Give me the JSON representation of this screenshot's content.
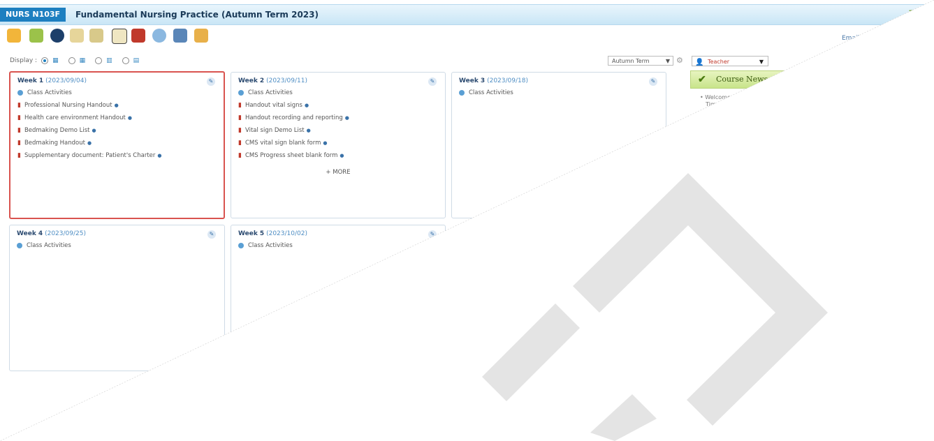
{
  "header": {
    "course_code": "NURS N103F",
    "course_title": "Fundamental Nursing Practice (Autumn Term 2023)",
    "brand": "m"
  },
  "toolbar": {
    "icons": [
      "home-icon",
      "folder-icon",
      "record-icon",
      "clipboard-icon",
      "clipboard-edit-icon",
      "document-icon",
      "books-icon",
      "clock-icon",
      "monitor-icon",
      "palette-icon"
    ],
    "email_label": "Email"
  },
  "display": {
    "label": "Display :",
    "options": [
      "grid-3-view",
      "grid-2-view",
      "single-view",
      "calendar-view"
    ]
  },
  "term": {
    "value": "Autumn Term"
  },
  "role": {
    "value": "Teacher"
  },
  "news": {
    "title": "Course News",
    "welcome": "Welcome",
    "body_tail": "Time"
  },
  "weeks": [
    {
      "title": "Week 1",
      "date": "(2023/09/04)",
      "activities": "Class Activities",
      "items": [
        "Professional Nursing Handout",
        "Health care environment Handout",
        "Bedmaking Demo List",
        "Bedmaking Handout",
        "Supplementary document: Patient's Charter"
      ]
    },
    {
      "title": "Week 2",
      "date": "(2023/09/11)",
      "activities": "Class Activities",
      "items": [
        "Handout vital signs",
        "Handout recording and reporting",
        "Vital sign Demo List",
        "CMS vital sign blank form",
        "CMS Progress sheet blank form"
      ],
      "more": "MORE"
    },
    {
      "title": "Week 3",
      "date": "(2023/09/18)",
      "activities": "Class Activities",
      "items": []
    },
    {
      "title": "Week 4",
      "date": "(2023/09/25)",
      "activities": "Class Activities",
      "items": []
    },
    {
      "title": "Week 5",
      "date": "(2023/10/02)",
      "activities": "Class Activities",
      "items": []
    }
  ]
}
